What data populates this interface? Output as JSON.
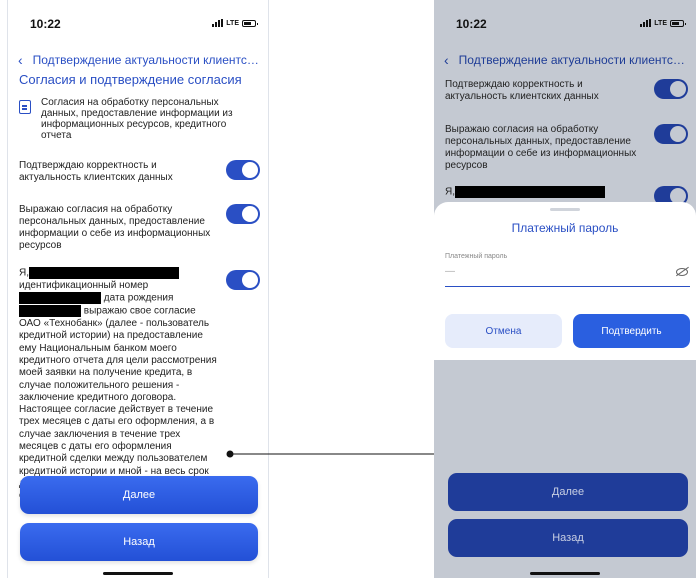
{
  "left": {
    "status": {
      "time": "10:22",
      "network": "LTE"
    },
    "nav": {
      "title": "Подтверждение актуальности клиентских данных"
    },
    "section_title": "Согласия и подтверждение согласия",
    "document": {
      "text": "Согласия на обработку персональных данных, предоставление информации из информационных ресурсов, кредитного отчета"
    },
    "toggles": [
      {
        "label": "Подтверждаю корректность и актуальность клиентских данных"
      },
      {
        "label": "Выражаю согласия на обработку персональных данных, предоставление информации о себе из информационных ресурсов"
      }
    ],
    "consent": {
      "prefix": "Я,",
      "line2": "идентификационный номер",
      "dob": "дата рождения",
      "express": "выражаю свое согласие",
      "body": "ОАО «Технобанк» (далее - пользователь кредитной истории) на предоставление ему Национальным банком моего кредитного отчета для цели рассмотрения моей заявки на получение кредита, в случае положительного решения - заключение кредитного договора. Настоящее согласие действует в течение трех месяцев с даты его оформления, а в случае заключения в течение трех месяцев с даты его оформления кредитной сделки между пользователем кредитной истории и мной - на весь срок действия указанной кредитной сделки по ее полному исполнению"
    },
    "buttons": {
      "next": "Далее",
      "back": "Назад"
    }
  },
  "right": {
    "status": {
      "time": "10:22",
      "network": "LTE"
    },
    "nav": {
      "title": "Подтверждение актуальности клиентских данных"
    },
    "toggles": [
      {
        "label": "Подтверждаю корректность и актуальность клиентских данных"
      },
      {
        "label": "Выражаю согласия на обработку персональных данных, предоставление информации о себе из информационных ресурсов"
      }
    ],
    "consent_prefix": "Я,",
    "sheet": {
      "title": "Платежный пароль",
      "field_label": "Платежный пароль",
      "field_value": "—",
      "cancel": "Отмена",
      "confirm": "Подтвердить"
    },
    "buttons": {
      "next": "Далее",
      "back": "Назад"
    }
  },
  "colors": {
    "accent": "#2a4fc4",
    "button": "#2a5fe0",
    "overlay": "#c4c9d2",
    "dim_button": "#1f3c99"
  }
}
